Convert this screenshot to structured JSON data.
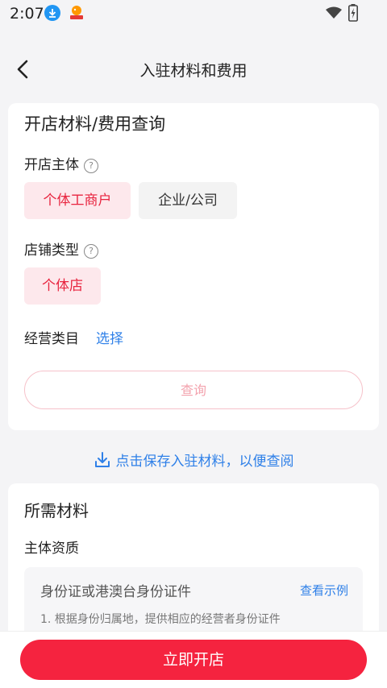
{
  "status_bar": {
    "time": "2:07"
  },
  "header": {
    "title": "入驻材料和费用"
  },
  "query_card": {
    "title": "开店材料/费用查询",
    "entity": {
      "label": "开店主体",
      "options": [
        "个体工商户",
        "企业/公司"
      ],
      "selected": "个体工商户"
    },
    "store_type": {
      "label": "店铺类型",
      "options": [
        "个体店"
      ],
      "selected": "个体店"
    },
    "category": {
      "label": "经营类目",
      "action": "选择"
    },
    "query_button": "查询"
  },
  "save_link": "点击保存入驻材料，以便查阅",
  "materials": {
    "title": "所需材料",
    "section": "主体资质",
    "doc": {
      "name": "身份证或港澳台身份证件",
      "example_link": "查看示例",
      "desc": "1. 根据身份归属地，提供相应的经营者身份证件"
    }
  },
  "bottom": {
    "open_button": "立即开店"
  },
  "colors": {
    "accent": "#f5233f",
    "link": "#2f80e8",
    "chip_selected_bg": "#fde8ec"
  }
}
